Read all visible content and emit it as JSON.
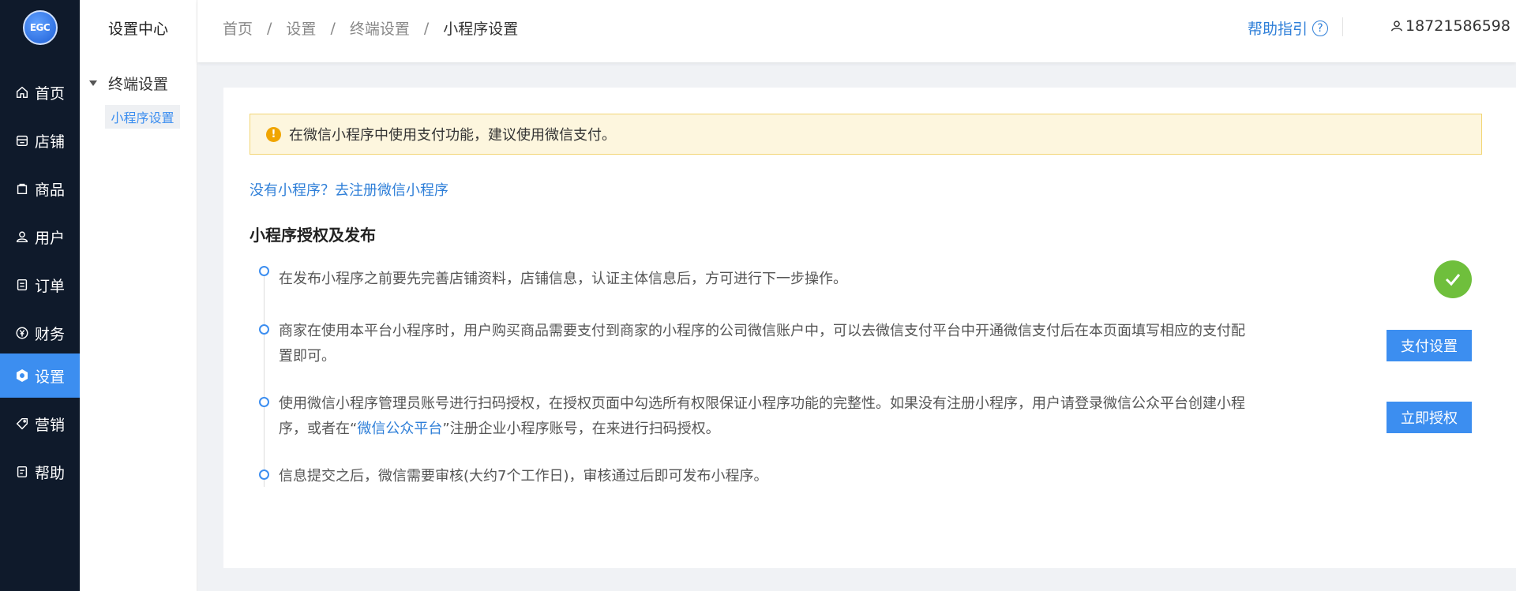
{
  "logo": {
    "text": "EGC"
  },
  "sidebar": {
    "items": [
      {
        "label": "首页",
        "icon": "home-icon"
      },
      {
        "label": "店铺",
        "icon": "store-icon"
      },
      {
        "label": "商品",
        "icon": "product-icon"
      },
      {
        "label": "用户",
        "icon": "user-icon"
      },
      {
        "label": "订单",
        "icon": "order-icon"
      },
      {
        "label": "财务",
        "icon": "yen-icon"
      },
      {
        "label": "设置",
        "icon": "settings-icon",
        "active": true
      },
      {
        "label": "营销",
        "icon": "tag-icon"
      },
      {
        "label": "帮助",
        "icon": "help-doc-icon"
      }
    ]
  },
  "submenu": {
    "title": "设置中心",
    "group": "终端设置",
    "active_item": "小程序设置"
  },
  "header": {
    "breadcrumb": [
      "首页",
      "设置",
      "终端设置",
      "小程序设置"
    ],
    "separator": "/",
    "help_label": "帮助指引",
    "help_glyph": "?",
    "user_phone": "18721586598"
  },
  "main": {
    "notice": "在微信小程序中使用支付功能，建议使用微信支付。",
    "notice_glyph": "!",
    "register_link": "没有小程序？去注册微信小程序",
    "section_title": "小程序授权及发布",
    "steps": [
      {
        "text": "在发布小程序之前要先完善店铺资料，店铺信息，认证主体信息后，方可进行下一步操作。",
        "status": "done"
      },
      {
        "text": "商家在使用本平台小程序时，用户购买商品需要支付到商家的小程序的公司微信账户中，可以去微信支付平台中开通微信支付后在本页面填写相应的支付配置即可。",
        "button": "支付设置"
      },
      {
        "text_before": "使用微信小程序管理员账号进行扫码授权，在授权页面中勾选所有权限保证小程序功能的完整性。如果没有注册小程序，用户请登录微信公众平台创建小程序，或者在“",
        "link": "微信公众平台",
        "text_after": "”注册企业小程序账号，在来进行扫码授权。",
        "button": "立即授权"
      },
      {
        "text": "信息提交之后，微信需要审核(大约7个工作日)，审核通过后即可发布小程序。"
      }
    ]
  },
  "colors": {
    "sidebar_bg": "#0f1a2b",
    "accent": "#3c8ef0",
    "link": "#2f7fd8",
    "success": "#6fbf3c",
    "warning": "#f0a500"
  }
}
